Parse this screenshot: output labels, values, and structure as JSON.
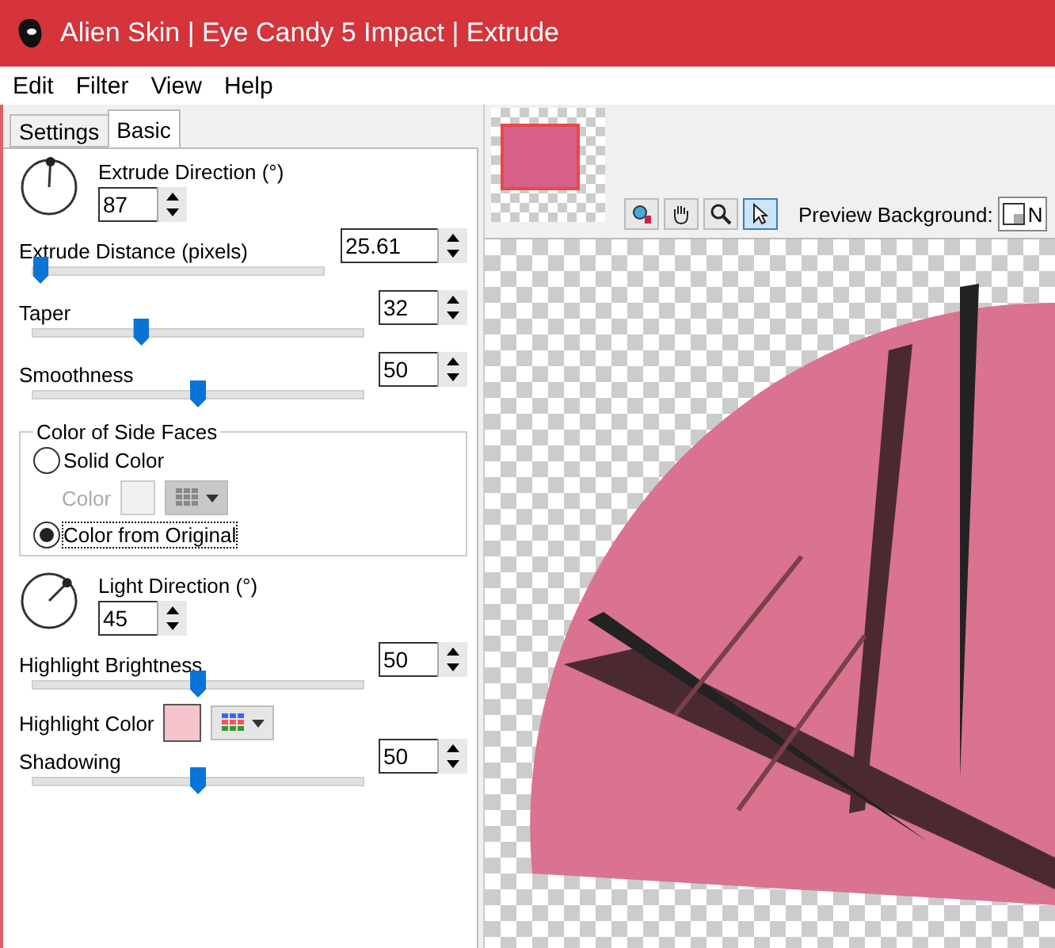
{
  "window": {
    "title": "Alien Skin | Eye Candy 5 Impact | Extrude"
  },
  "menu": [
    "Edit",
    "Filter",
    "View",
    "Help"
  ],
  "tabs": [
    {
      "label": "Settings",
      "selected": false
    },
    {
      "label": "Basic",
      "selected": true
    }
  ],
  "extrude_direction": {
    "label": "Extrude Direction (°)",
    "value": "87"
  },
  "sliders_top": [
    {
      "label": "Extrude Distance (pixels)",
      "value": "25.61",
      "level": 0.03
    },
    {
      "label": "Taper",
      "value": "32",
      "level": 0.33
    },
    {
      "label": "Smoothness",
      "value": "50",
      "level": 0.5
    }
  ],
  "side_faces": {
    "title": "Color of Side Faces",
    "options": [
      {
        "label": "Solid Color",
        "selected": false
      },
      {
        "label": "Color from Original",
        "selected": true
      }
    ],
    "color_label": "Color",
    "color_disabled": true
  },
  "light_direction": {
    "label": "Light Direction (°)",
    "value": "45"
  },
  "highlight_brightness": {
    "label": "Highlight Brightness",
    "value": "50",
    "level": 0.5
  },
  "highlight_color": {
    "label": "Highlight Color",
    "color": "#f5c4cc"
  },
  "shadowing": {
    "label": "Shadowing",
    "value": "50",
    "level": 0.5
  },
  "preview": {
    "background_label": "Preview Background:",
    "background_value": "N"
  }
}
